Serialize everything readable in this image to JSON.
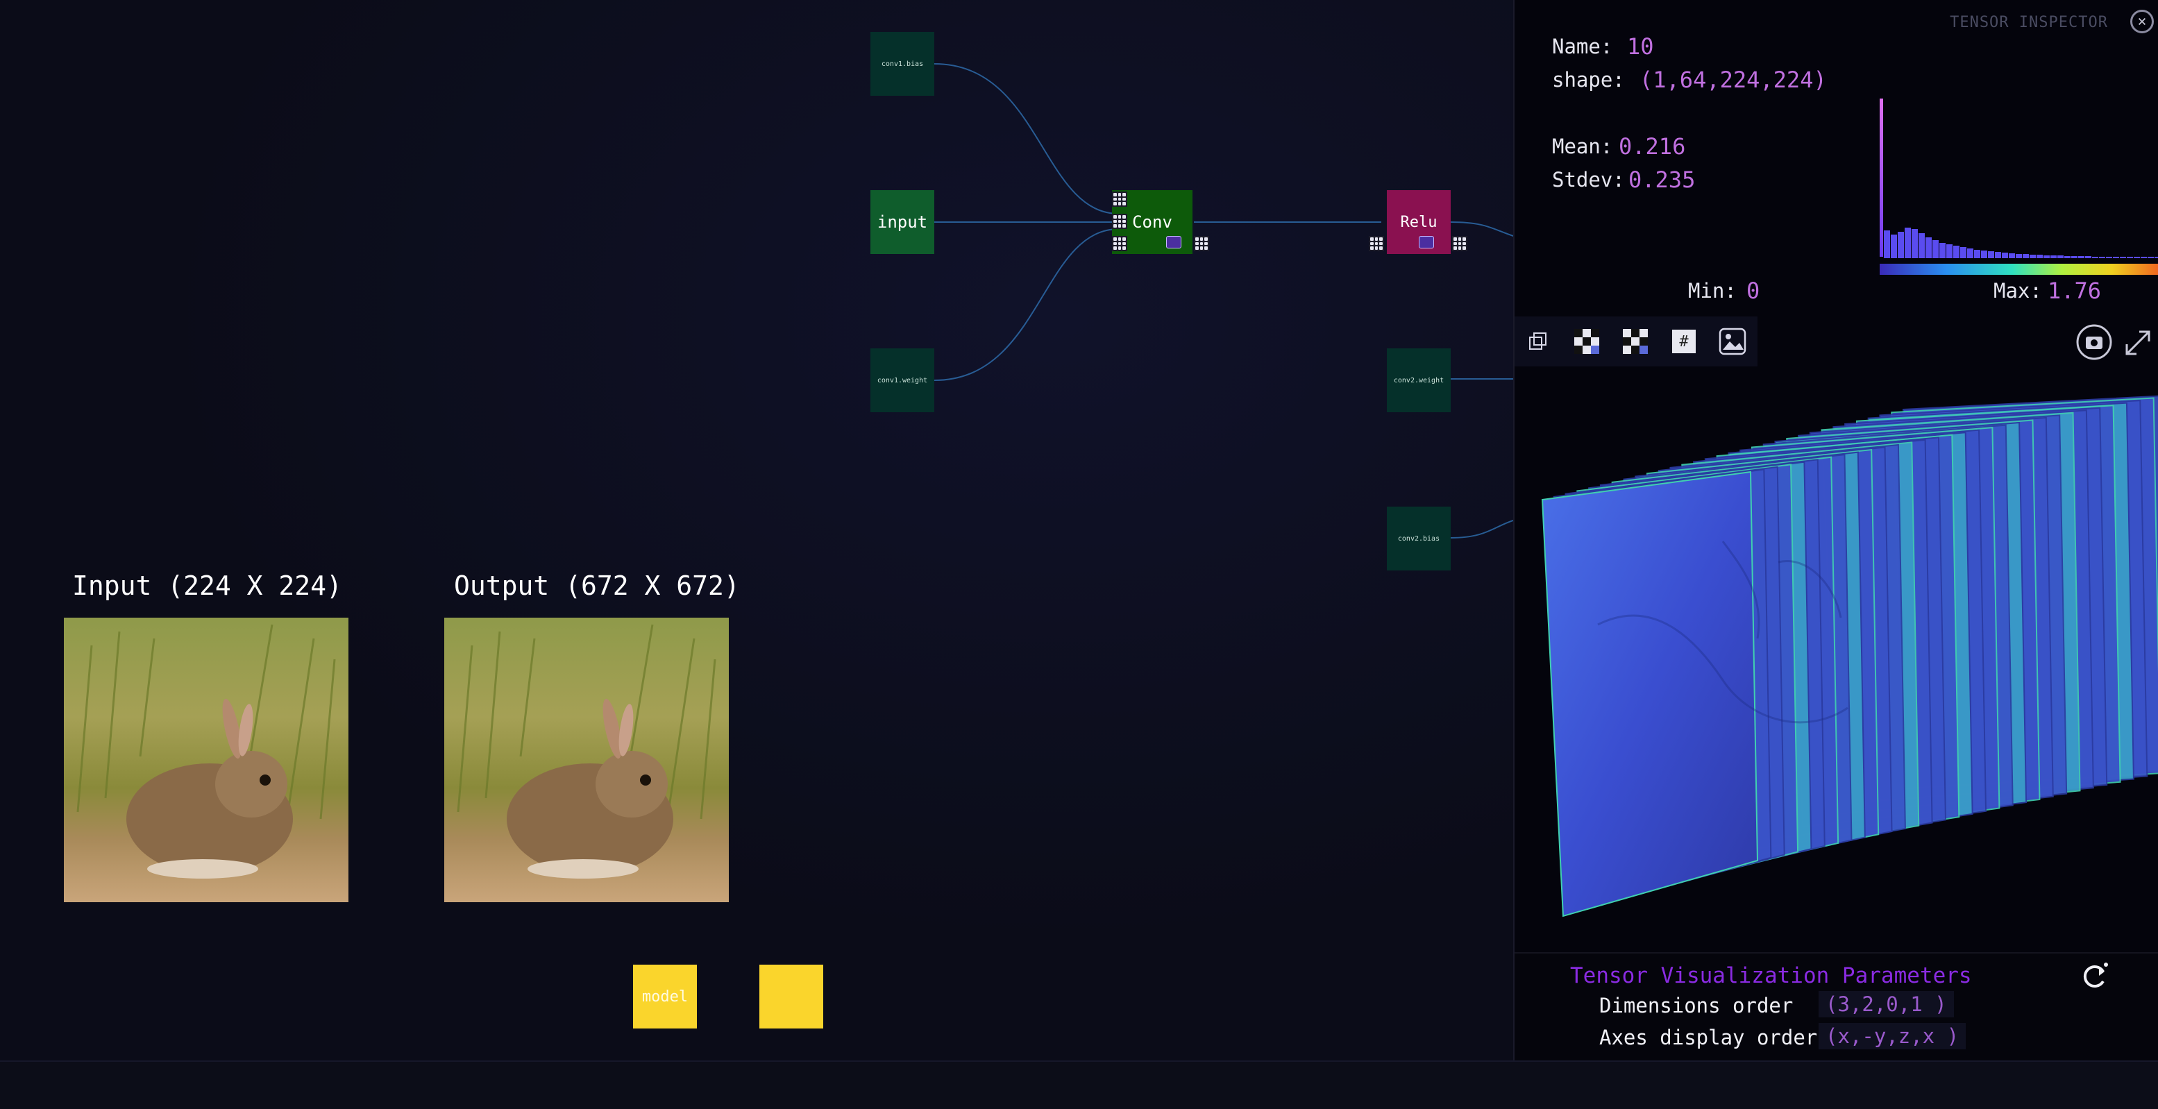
{
  "graph": {
    "nodes": {
      "conv1_bias": "conv1.bias",
      "input": "input",
      "conv1_weight": "conv1.weight",
      "conv": "Conv",
      "relu": "Relu",
      "conv2_weight": "conv2.weight",
      "conv2_bias": "conv2.bias",
      "model": "model",
      "yellow2": "tensor-id-small"
    },
    "colors": {
      "node_green": "#0f5d2c",
      "node_relu": "#8a1150",
      "node_yellow": "#fad52c",
      "edge": "#2d6aa8"
    }
  },
  "images": {
    "input_title": "Input (224 X 224)",
    "output_title": "Output (672 X 672)"
  },
  "inspector": {
    "title": "TENSOR INSPECTOR",
    "name_label": "Name:",
    "name_value": "10",
    "shape_label": "shape:",
    "shape_value": "(1,64,224,224)",
    "mean_label": "Mean:",
    "mean_value": "0.216",
    "stdev_label": "Stdev:",
    "stdev_value": "0.235",
    "min_label": "Min:",
    "min_value": "0",
    "max_label": "Max:",
    "max_value": "1.76",
    "toolbar": [
      "copy-icon",
      "checker-icon",
      "checker-alt-icon",
      "grid-hash-icon",
      "image-icon"
    ],
    "hash_glyph": "#",
    "colors": {
      "accent": "#c070e0",
      "histogram": "#5a4cf0"
    }
  },
  "params": {
    "title": "Tensor Visualization Parameters",
    "dims_label": "Dimensions order",
    "dims_value": "(3,2,0,1 )",
    "axes_label": "Axes display order",
    "axes_value": "(x,-y,z,x )"
  }
}
